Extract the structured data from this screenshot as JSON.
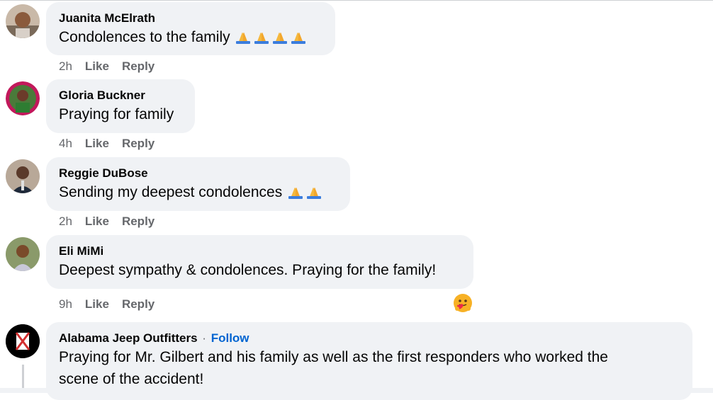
{
  "comments": [
    {
      "author": "Juanita McElrath",
      "text": "Condolences to the family",
      "emoji_count": 4,
      "time": "2h",
      "like": "Like",
      "reply": "Reply"
    },
    {
      "author": "Gloria Buckner",
      "text": "Praying for family",
      "emoji_count": 0,
      "time": "4h",
      "like": "Like",
      "reply": "Reply"
    },
    {
      "author": "Reggie DuBose",
      "text": "Sending my deepest condolences",
      "emoji_count": 2,
      "time": "2h",
      "like": "Like",
      "reply": "Reply"
    },
    {
      "author": "Eli MiMi",
      "text": "Deepest sympathy & condolences. Praying for the family!",
      "emoji_count": 0,
      "time": "9h",
      "like": "Like",
      "reply": "Reply",
      "reaction_icon": "care-reaction-icon"
    },
    {
      "author": "Alabama Jeep Outfitters",
      "follow": "Follow",
      "separator": "·",
      "text_line1": "Praying for Mr. Gilbert and his family as well as the first responders who worked the",
      "text_line2": "scene of the accident!"
    }
  ],
  "colors": {
    "bubble": "#f0f2f5",
    "meta_text": "#65676b",
    "link": "#0064d1"
  }
}
